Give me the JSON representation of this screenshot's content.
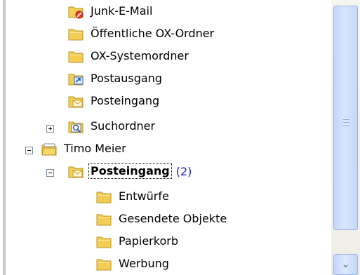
{
  "tree": {
    "items": [
      {
        "label": "Junk-E-Mail",
        "icon": "junk-mail-folder-icon"
      },
      {
        "label": "Öffentliche OX-Ordner",
        "icon": "folder-icon"
      },
      {
        "label": "OX-Systemordner",
        "icon": "folder-icon"
      },
      {
        "label": "Postausgang",
        "icon": "outbox-folder-icon"
      },
      {
        "label": "Posteingang",
        "icon": "inbox-folder-icon"
      },
      {
        "label": "Suchordner",
        "icon": "search-folder-icon",
        "expander": "+"
      },
      {
        "label": "Timo Meier",
        "icon": "mailbox-icon",
        "expander": "-"
      },
      {
        "label": "Posteingang",
        "icon": "inbox-folder-icon",
        "expander": "-",
        "count": "(2)",
        "selected": true
      },
      {
        "label": "Entwürfe",
        "icon": "folder-icon"
      },
      {
        "label": "Gesendete Objekte",
        "icon": "folder-icon"
      },
      {
        "label": "Papierkorb",
        "icon": "folder-icon"
      },
      {
        "label": "Werbung",
        "icon": "folder-icon"
      }
    ]
  },
  "colors": {
    "folder": "#f4cd55",
    "count": "#1a1ad0",
    "scrollbar_thumb": "#c4d6fb"
  },
  "scrollbar": {
    "down_arrow_icon": "chevron-down-icon"
  }
}
